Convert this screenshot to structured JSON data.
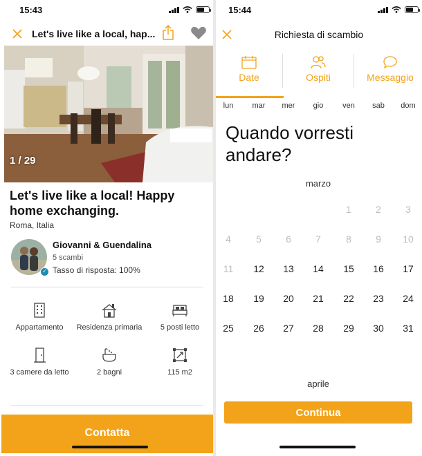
{
  "left": {
    "status_time": "15:43",
    "nav_title": "Let's live like a local, hap...",
    "photo_counter": "1 / 29",
    "title": "Let's live like a local! Happy home exchanging.",
    "location": "Roma, Italia",
    "host": {
      "name": "Giovanni & Guendalina",
      "exchanges": "5 scambi",
      "response_rate": "Tasso di risposta: 100%"
    },
    "features": [
      {
        "label": "Appartamento",
        "icon": "building-icon"
      },
      {
        "label": "Residenza primaria",
        "icon": "house-icon"
      },
      {
        "label": "5 posti letto",
        "icon": "bed-icon"
      },
      {
        "label": "3 camere da letto",
        "icon": "door-icon"
      },
      {
        "label": "2 bagni",
        "icon": "bathtub-icon"
      },
      {
        "label": "115 m2",
        "icon": "area-icon"
      }
    ],
    "contact_label": "Contatta"
  },
  "right": {
    "status_time": "15:44",
    "nav_title": "Richiesta di scambio",
    "tabs": [
      {
        "label": "Date",
        "icon": "calendar-icon"
      },
      {
        "label": "Ospiti",
        "icon": "people-icon"
      },
      {
        "label": "Messaggio",
        "icon": "chat-icon"
      }
    ],
    "weekdays": [
      "lun",
      "mar",
      "mer",
      "gio",
      "ven",
      "sab",
      "dom"
    ],
    "question": "Quando vorresti andare?",
    "month_current": "marzo",
    "month_next": "aprile",
    "calendar_rows": [
      [
        null,
        null,
        null,
        null,
        "1",
        "2",
        "3"
      ],
      [
        "4",
        "5",
        "6",
        "7",
        "8",
        "9",
        "10"
      ],
      [
        "11",
        "12",
        "13",
        "14",
        "15",
        "16",
        "17"
      ],
      [
        "18",
        "19",
        "20",
        "21",
        "22",
        "23",
        "24"
      ],
      [
        "25",
        "26",
        "27",
        "28",
        "29",
        "30",
        "31"
      ]
    ],
    "first_available_day": "12",
    "continue_label": "Continua"
  },
  "colors": {
    "accent": "#f3a31a",
    "disabled_day": "#bdbdbd",
    "verified_badge": "#1c8bb1"
  }
}
